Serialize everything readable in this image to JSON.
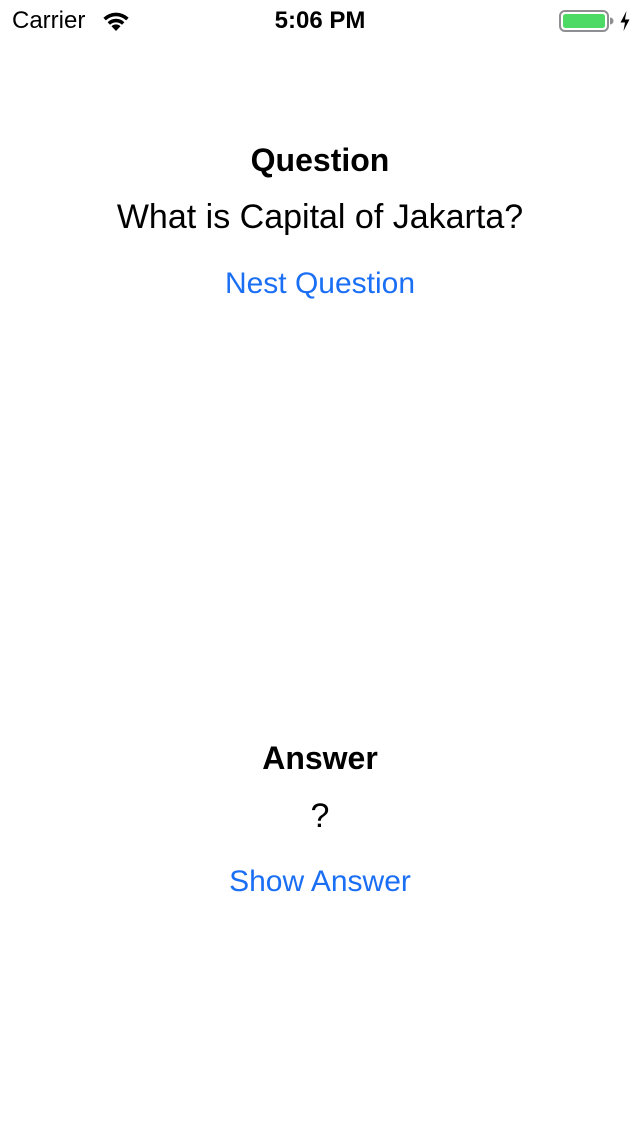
{
  "status_bar": {
    "carrier": "Carrier",
    "time": "5:06 PM",
    "battery_color": "#4cd964",
    "icons": [
      "wifi-icon",
      "battery-icon",
      "charging-bolt-icon"
    ]
  },
  "question": {
    "title": "Question",
    "text": "What is Capital of Jakarta?",
    "button_label": "Nest Question"
  },
  "answer": {
    "title": "Answer",
    "text": "?",
    "button_label": "Show Answer"
  },
  "colors": {
    "accent": "#1a6ff5",
    "text": "#000000",
    "background": "#ffffff"
  }
}
